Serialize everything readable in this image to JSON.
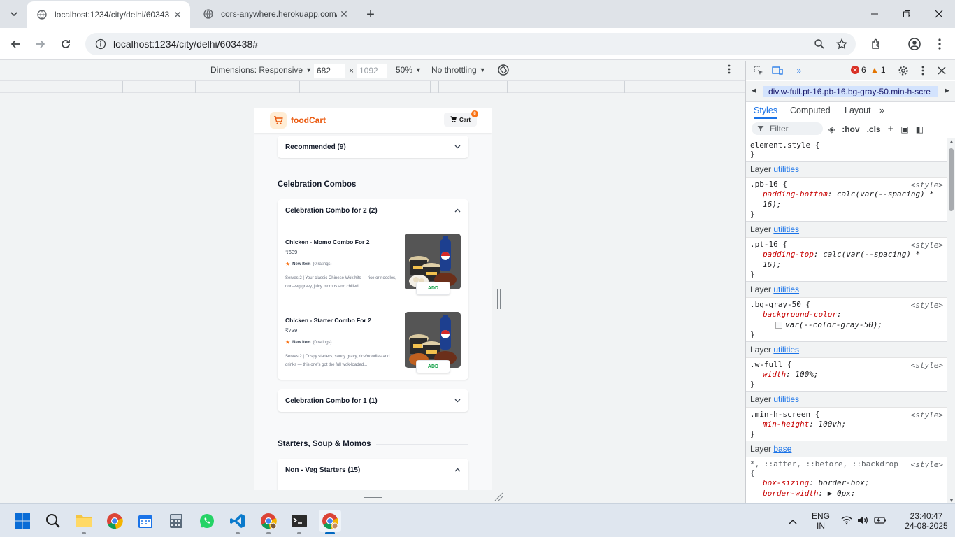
{
  "browser": {
    "tabs": [
      {
        "title": "localhost:1234/city/delhi/60343",
        "active": true
      },
      {
        "title": "cors-anywhere.herokuapp.com/",
        "active": false
      }
    ],
    "url": "localhost:1234/city/delhi/603438#"
  },
  "device_toolbar": {
    "dimensions_label": "Dimensions: Responsive",
    "width": "682",
    "height": "1092",
    "zoom": "50%",
    "throttling": "No throttling",
    "times": "×"
  },
  "app": {
    "brand": "foodCart",
    "cart_label": "Cart",
    "cart_count": "8",
    "accordions": {
      "recommended": "Recommended (9)",
      "combo2": "Celebration Combo for 2 (2)",
      "combo1": "Celebration Combo for 1 (1)",
      "nonveg": "Non - Veg Starters (15)"
    },
    "sections": {
      "celebration": "Celebration Combos",
      "starters": "Starters, Soup & Momos"
    },
    "items": [
      {
        "name": "Chicken - Momo Combo For 2",
        "price": "₹639",
        "rating_label": "New Item",
        "rating_count": "(0 ratings)",
        "description": "Serves 2 | Your classic Chinese Wok hits — rice or noodles, non-veg gravy, juicy momos and chilled...",
        "add_label": "ADD"
      },
      {
        "name": "Chicken - Starter Combo For 2",
        "price": "₹739",
        "rating_label": "New Item",
        "rating_count": "(0 ratings)",
        "description": "Serves 2 | Crispy starters, saucy gravy, rice/noodles and drinks — this one's got the full wok-loaded...",
        "add_label": "ADD"
      }
    ]
  },
  "devtools": {
    "errors": "6",
    "warnings": "1",
    "breadcrumb": "div.w-full.pt-16.pb-16.bg-gray-50.min-h-scre",
    "subtabs": [
      "Styles",
      "Computed",
      "Layout"
    ],
    "filter_placeholder": "Filter",
    "hov": ":hov",
    "cls": ".cls",
    "element_style": "element.style {",
    "close_brace": "}",
    "layer_word": "Layer",
    "source": "<style>",
    "rules": [
      {
        "layer": "utilities",
        "selector": ".pb-16 {",
        "decls": [
          [
            "padding-bottom",
            "calc(var(--spacing) * 16);"
          ]
        ]
      },
      {
        "layer": "utilities",
        "selector": ".pt-16 {",
        "decls": [
          [
            "padding-top",
            "calc(var(--spacing) * 16);"
          ]
        ]
      },
      {
        "layer": "utilities",
        "selector": ".bg-gray-50 {",
        "decls": [
          [
            "background-color",
            "var(--color-gray-50);"
          ]
        ]
      },
      {
        "layer": "utilities",
        "selector": ".w-full {",
        "decls": [
          [
            "width",
            "100%;"
          ]
        ]
      },
      {
        "layer": "utilities",
        "selector": ".min-h-screen {",
        "decls": [
          [
            "min-height",
            "100vh;"
          ]
        ]
      },
      {
        "layer": "base",
        "selector": "*, ::after, ::before, ::backdrop {",
        "decls": [
          [
            "box-sizing",
            "border-box;"
          ],
          [
            "border-width",
            "▶ 0px;"
          ]
        ]
      }
    ]
  },
  "taskbar": {
    "lang1": "ENG",
    "lang2": "IN",
    "time": "23:40:47",
    "date": "24-08-2025"
  },
  "colors": {
    "brand": "#ea580c",
    "add": "#16a34a",
    "accent": "#1a73e8"
  }
}
